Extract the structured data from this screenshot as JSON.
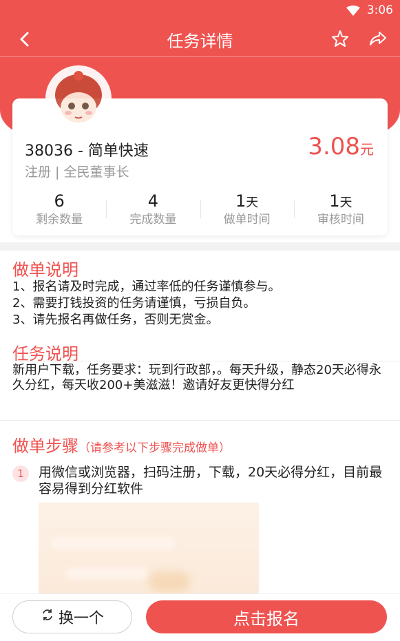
{
  "status_bar": {
    "time": "3:06"
  },
  "toolbar": {
    "title": "任务详情"
  },
  "task": {
    "title": "38036 - 简单快速",
    "subtitle": "注册 | 全民董事长",
    "price": "3.08",
    "price_unit": "元"
  },
  "stats": [
    {
      "value": "6",
      "unit": "",
      "label": "剩余数量"
    },
    {
      "value": "4",
      "unit": "",
      "label": "完成数量"
    },
    {
      "value": "1",
      "unit": "天",
      "label": "做单时间"
    },
    {
      "value": "1",
      "unit": "天",
      "label": "审核时间"
    }
  ],
  "instructions": {
    "title": "做单说明",
    "lines": [
      "1、报名请及时完成，通过率低的任务谨慎参与。",
      "2、需要打钱投资的任务请谨慎，亏损自负。",
      "3、请先报名再做任务，否则无赏金。"
    ]
  },
  "task_description": {
    "title": "任务说明",
    "text": "新用户下载，任务要求：玩到行政部，。每天升级，静态20天必得永久分红，每天收200+美滋滋！邀请好友更快得分红"
  },
  "steps": {
    "title": "做单步骤",
    "hint": "（请参考以下步骤完成做单）",
    "items": [
      {
        "number": "1",
        "text": "用微信或浏览器，扫码注册，下载，20天必得分红，目前最容易得到分红软件"
      }
    ]
  },
  "bottom": {
    "change_label": "换一个",
    "signup_label": "点击报名"
  },
  "colors": {
    "accent": "#ef5350"
  },
  "icons": [
    "wifi-icon",
    "back-arrow-icon",
    "star-icon",
    "share-icon",
    "refresh-icon"
  ]
}
